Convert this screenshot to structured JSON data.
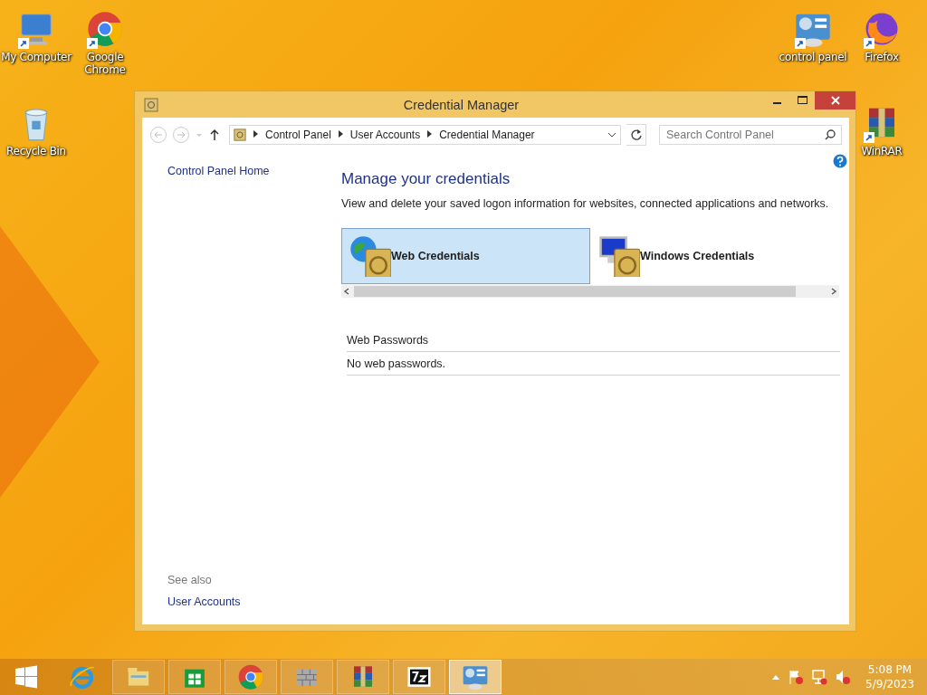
{
  "desktop_icons": [
    {
      "label": "My Computer",
      "kind": "computer"
    },
    {
      "label": "Google Chrome",
      "kind": "chrome"
    },
    {
      "label": "control panel",
      "kind": "panel"
    },
    {
      "label": "Firefox",
      "kind": "firefox"
    },
    {
      "label": "Recycle Bin",
      "kind": "bin"
    },
    {
      "label": "WinRAR",
      "kind": "rar"
    }
  ],
  "window": {
    "title": "Credential Manager",
    "breadcrumbs": [
      "Control Panel",
      "User Accounts",
      "Credential Manager"
    ],
    "search": {
      "placeholder": "Search Control Panel"
    },
    "sidebar": {
      "home_link": "Control Panel Home",
      "see_also_heading": "See also",
      "see_also_links": [
        "User Accounts"
      ]
    },
    "heading": "Manage your credentials",
    "description": "View and delete your saved logon information for websites, connected applications and networks.",
    "credential_tabs": [
      {
        "label": "Web Credentials",
        "kind": "web",
        "selected": true
      },
      {
        "label": "Windows Credentials",
        "kind": "windows",
        "selected": false
      }
    ],
    "section": {
      "title": "Web Passwords",
      "empty_message": "No web passwords."
    }
  },
  "taskbar": {
    "apps": [
      {
        "kind": "ie",
        "active": false
      },
      {
        "kind": "explorer",
        "active": false
      },
      {
        "kind": "store",
        "active": false
      },
      {
        "kind": "chrome",
        "active": false
      },
      {
        "kind": "wall",
        "active": false
      },
      {
        "kind": "rar",
        "active": false
      },
      {
        "kind": "sevenzip",
        "active": false
      },
      {
        "kind": "panel",
        "active": true
      }
    ],
    "clock": {
      "time": "5:08 PM",
      "date": "5/9/2023"
    }
  }
}
